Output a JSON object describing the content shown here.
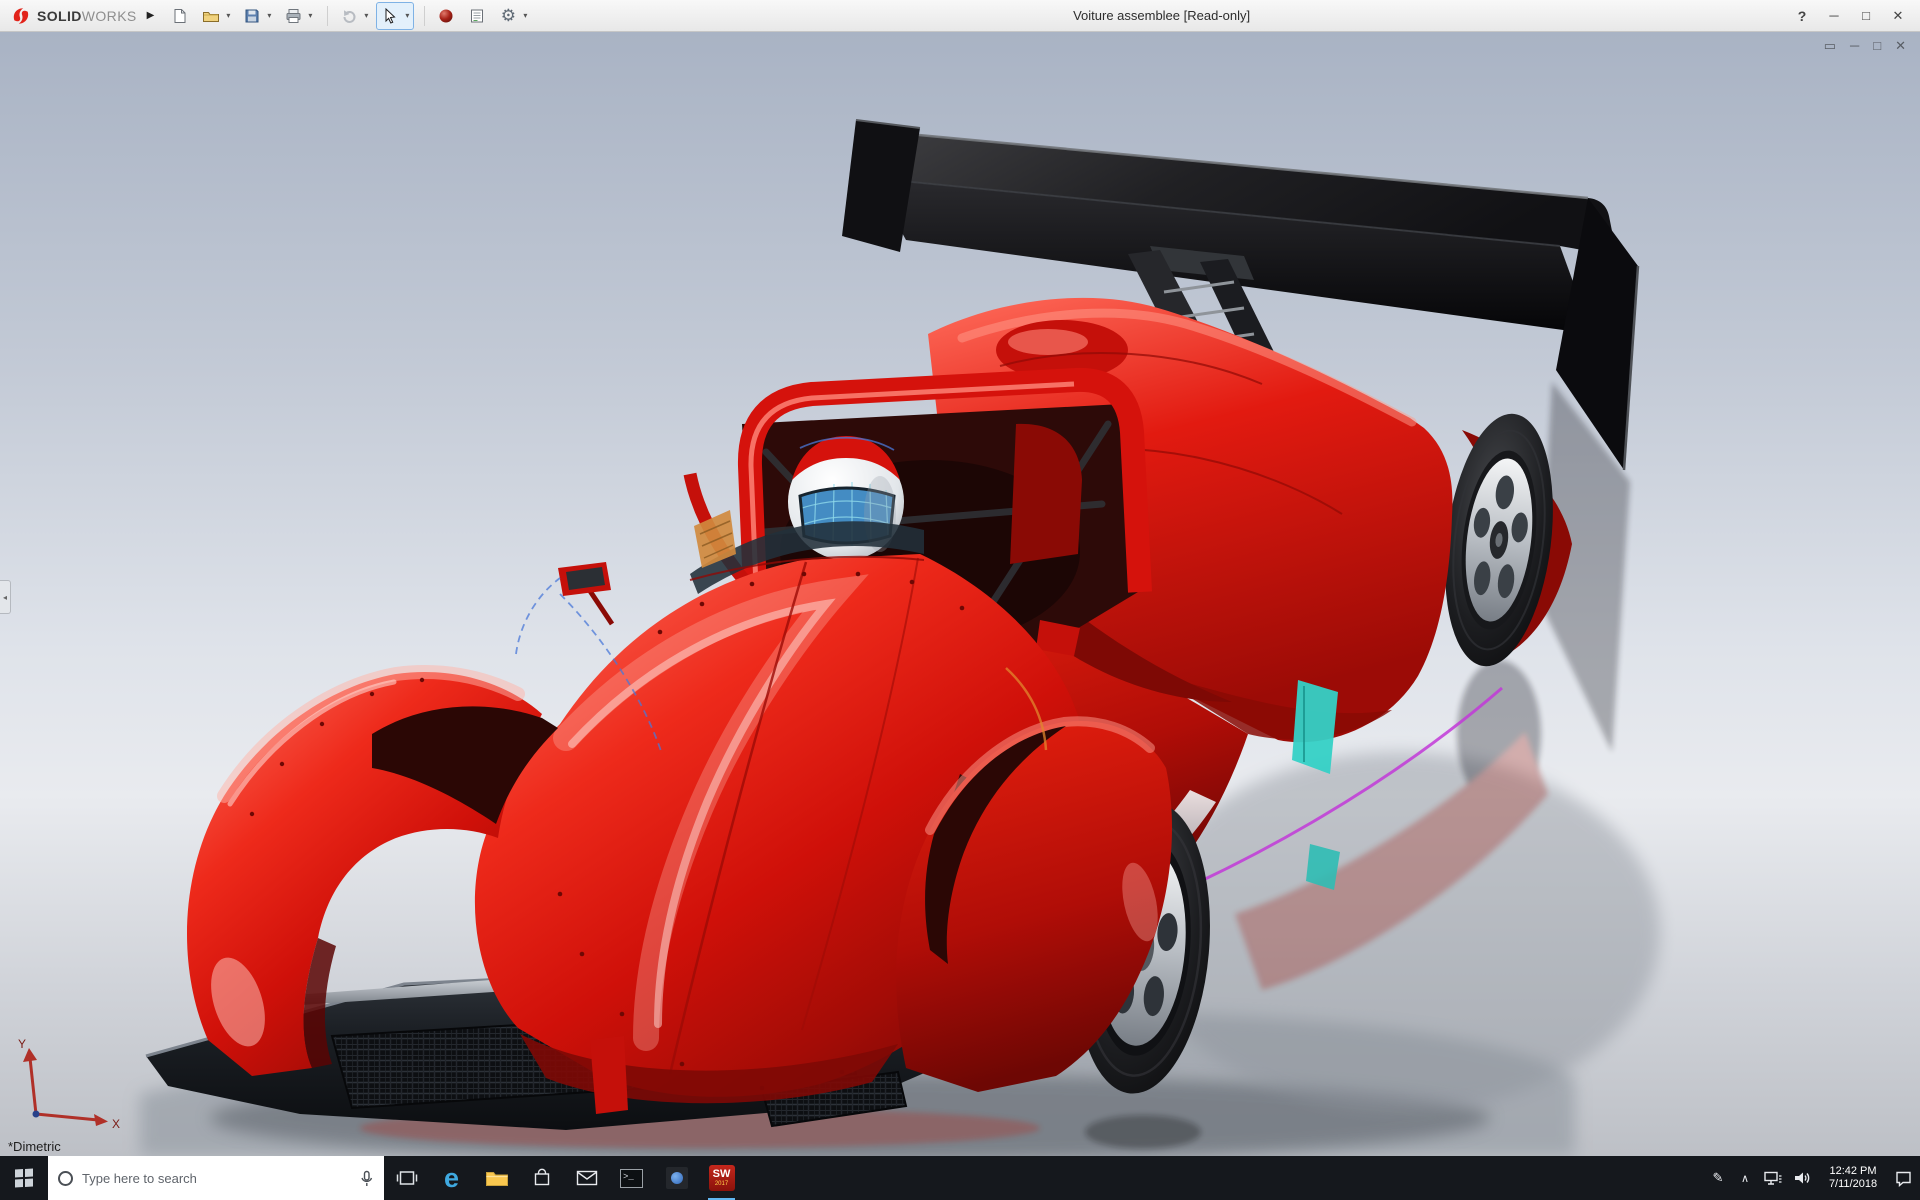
{
  "glyphs": {
    "expander": "▶",
    "dropdown": "▾",
    "help": "?",
    "minimize": "─",
    "maximize": "□",
    "close": "✕",
    "gear": "⚙",
    "flyout_handle": "◂",
    "edge": "e",
    "prompt": ">_",
    "pen": "✎",
    "chevron_up": "∧"
  },
  "window": {
    "brand_bold": "SOLID",
    "brand_light": "WORKS",
    "title": "Voiture assemblee [Read-only]"
  },
  "document_window": {
    "controls": [
      "▭",
      "─",
      "□",
      "✕"
    ]
  },
  "viewport": {
    "view_orientation_label": "*Dimetric",
    "triad": {
      "x_label": "X",
      "y_label": "Y"
    }
  },
  "model": {
    "name": "Voiture assemblee",
    "body_color": "#d5120c",
    "wing_color": "#0d0d0d",
    "accent_teal": "#35d1c6",
    "accent_magenta": "#c238d8",
    "background_top": "#a9b3c4",
    "background_bottom": "#bdc0c6"
  },
  "taskbar": {
    "search": {
      "placeholder": "Type here to search"
    },
    "solidworks_badge": {
      "label": "SW",
      "version": "2017"
    },
    "clock": {
      "time": "12:42 PM",
      "date": "7/11/2018"
    }
  }
}
